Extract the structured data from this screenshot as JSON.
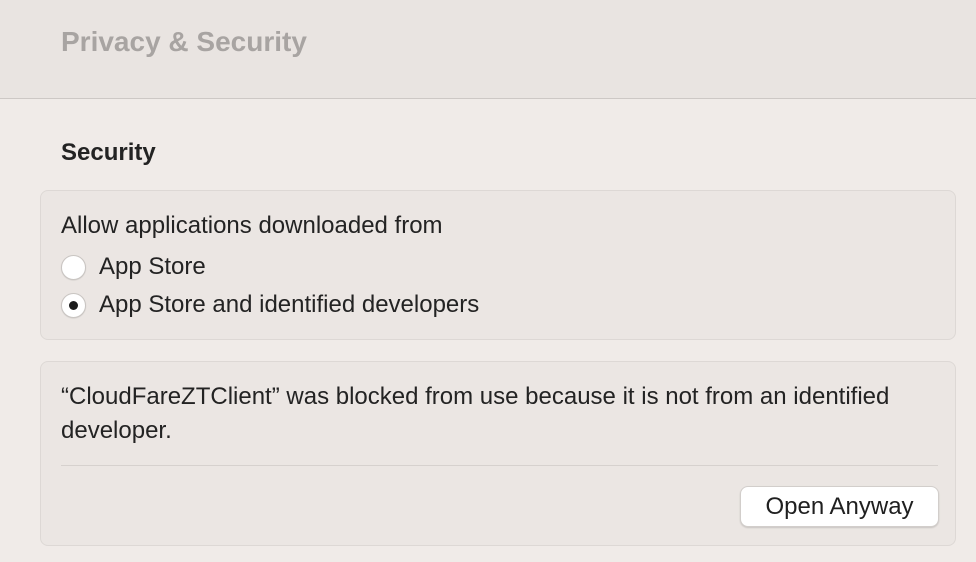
{
  "window": {
    "title": "Privacy & Security"
  },
  "security": {
    "section_title": "Security",
    "allow_heading": "Allow applications downloaded from",
    "options": [
      {
        "label": "App Store",
        "selected": false
      },
      {
        "label": "App Store and identified developers",
        "selected": true
      }
    ]
  },
  "blocked": {
    "message": "“CloudFareZTClient” was blocked from use because it is not from an identified developer.",
    "button_label": "Open Anyway"
  }
}
